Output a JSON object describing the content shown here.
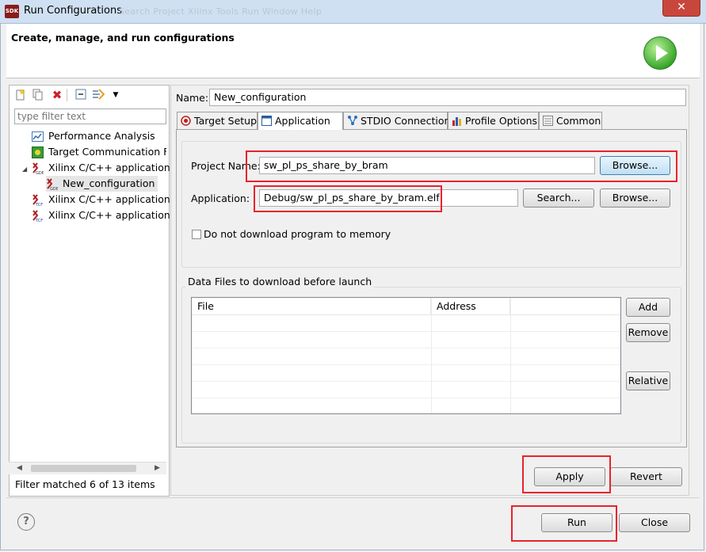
{
  "window": {
    "title": "Run Configurations",
    "app_icon_text": "SDK",
    "ghost_menu": "Search   Project   Xilinx Tools   Run   Window   Help",
    "close_glyph": "✕"
  },
  "header": {
    "title": "Create, manage, and run configurations"
  },
  "left_panel": {
    "filter_placeholder": "type filter text",
    "tree_items": [
      {
        "label": "Performance Analysis",
        "icon": "performance-icon"
      },
      {
        "label": "Target Communication Fr",
        "icon": "tcf-icon"
      },
      {
        "label": "Xilinx C/C++ application",
        "icon": "xilinx-gdb-icon",
        "expanded": true
      },
      {
        "label": "New_configuration",
        "icon": "xilinx-gdb-icon",
        "selected": true
      },
      {
        "label": "Xilinx C/C++ application",
        "icon": "xilinx-tcf-icon"
      },
      {
        "label": "Xilinx C/C++ application",
        "icon": "xilinx-tcf-icon"
      }
    ],
    "status": "Filter matched 6 of 13 items",
    "toolbar_icons": [
      "new-config-icon",
      "duplicate-icon",
      "delete-icon",
      "collapse-all-icon",
      "filter-icon",
      "dropdown-icon"
    ]
  },
  "config": {
    "name_label": "Name:",
    "name_value": "New_configuration",
    "tabs": [
      {
        "label": "Target Setup",
        "icon": "target-icon"
      },
      {
        "label": "Application",
        "icon": "application-icon",
        "active": true
      },
      {
        "label": "STDIO Connection",
        "icon": "stdio-icon"
      },
      {
        "label": "Profile Options",
        "icon": "profile-icon"
      },
      {
        "label": "Common",
        "icon": "common-icon"
      }
    ],
    "project_name_label": "Project Name:",
    "project_name_value": "sw_pl_ps_share_by_bram",
    "application_label": "Application:",
    "application_value": "Debug/sw_pl_ps_share_by_bram.elf",
    "browse_label": "Browse...",
    "search_label": "Search...",
    "no_download_label": "Do not download program to memory",
    "no_download_checked": false,
    "data_files_legend": "Data Files to download before launch",
    "table_headers": [
      "File",
      "Address",
      ""
    ],
    "add_label": "Add",
    "remove_label": "Remove",
    "relative_label": "Relative"
  },
  "actions": {
    "apply_label": "Apply",
    "revert_label": "Revert",
    "run_label": "Run",
    "close_label": "Close",
    "help_glyph": "?"
  },
  "colors": {
    "highlight_box": "#e8232c",
    "selection": "#cce8ff"
  }
}
